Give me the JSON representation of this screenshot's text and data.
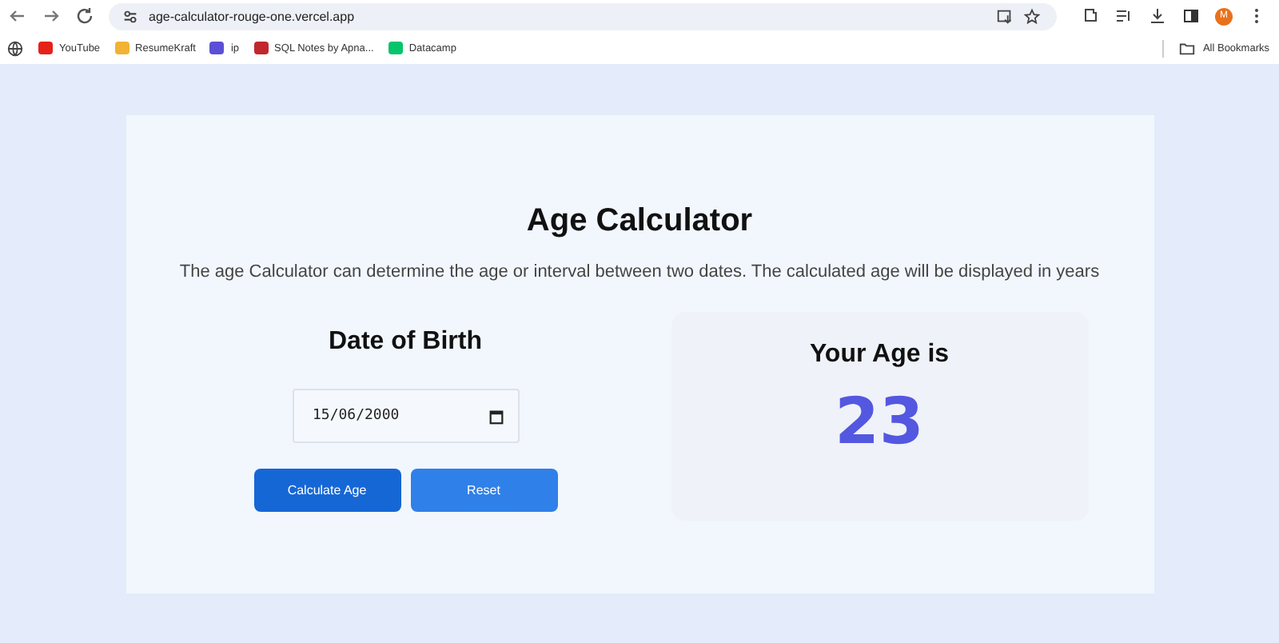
{
  "browser": {
    "url": "age-calculator-rouge-one.vercel.app",
    "profile_initial": "M",
    "bookmarks": [
      {
        "label": "YouTube",
        "color": "#e62117"
      },
      {
        "label": "ResumeKraft",
        "color": "#f2b233"
      },
      {
        "label": "ip",
        "color": "#5b4fd6"
      },
      {
        "label": "SQL Notes by Apna...",
        "color": "#c1272d"
      },
      {
        "label": "Datacamp",
        "color": "#05c46b"
      }
    ],
    "all_bookmarks": "All Bookmarks"
  },
  "page": {
    "title": "Age Calculator",
    "description": "The age Calculator can determine the age or interval between two dates. The calculated age will be displayed in years",
    "form": {
      "heading": "Date of Birth",
      "date_value": "15/06/2000",
      "buttons": [
        "Calculate Age",
        "Reset"
      ]
    },
    "result": {
      "heading": "Your Age is",
      "age": "23"
    }
  }
}
